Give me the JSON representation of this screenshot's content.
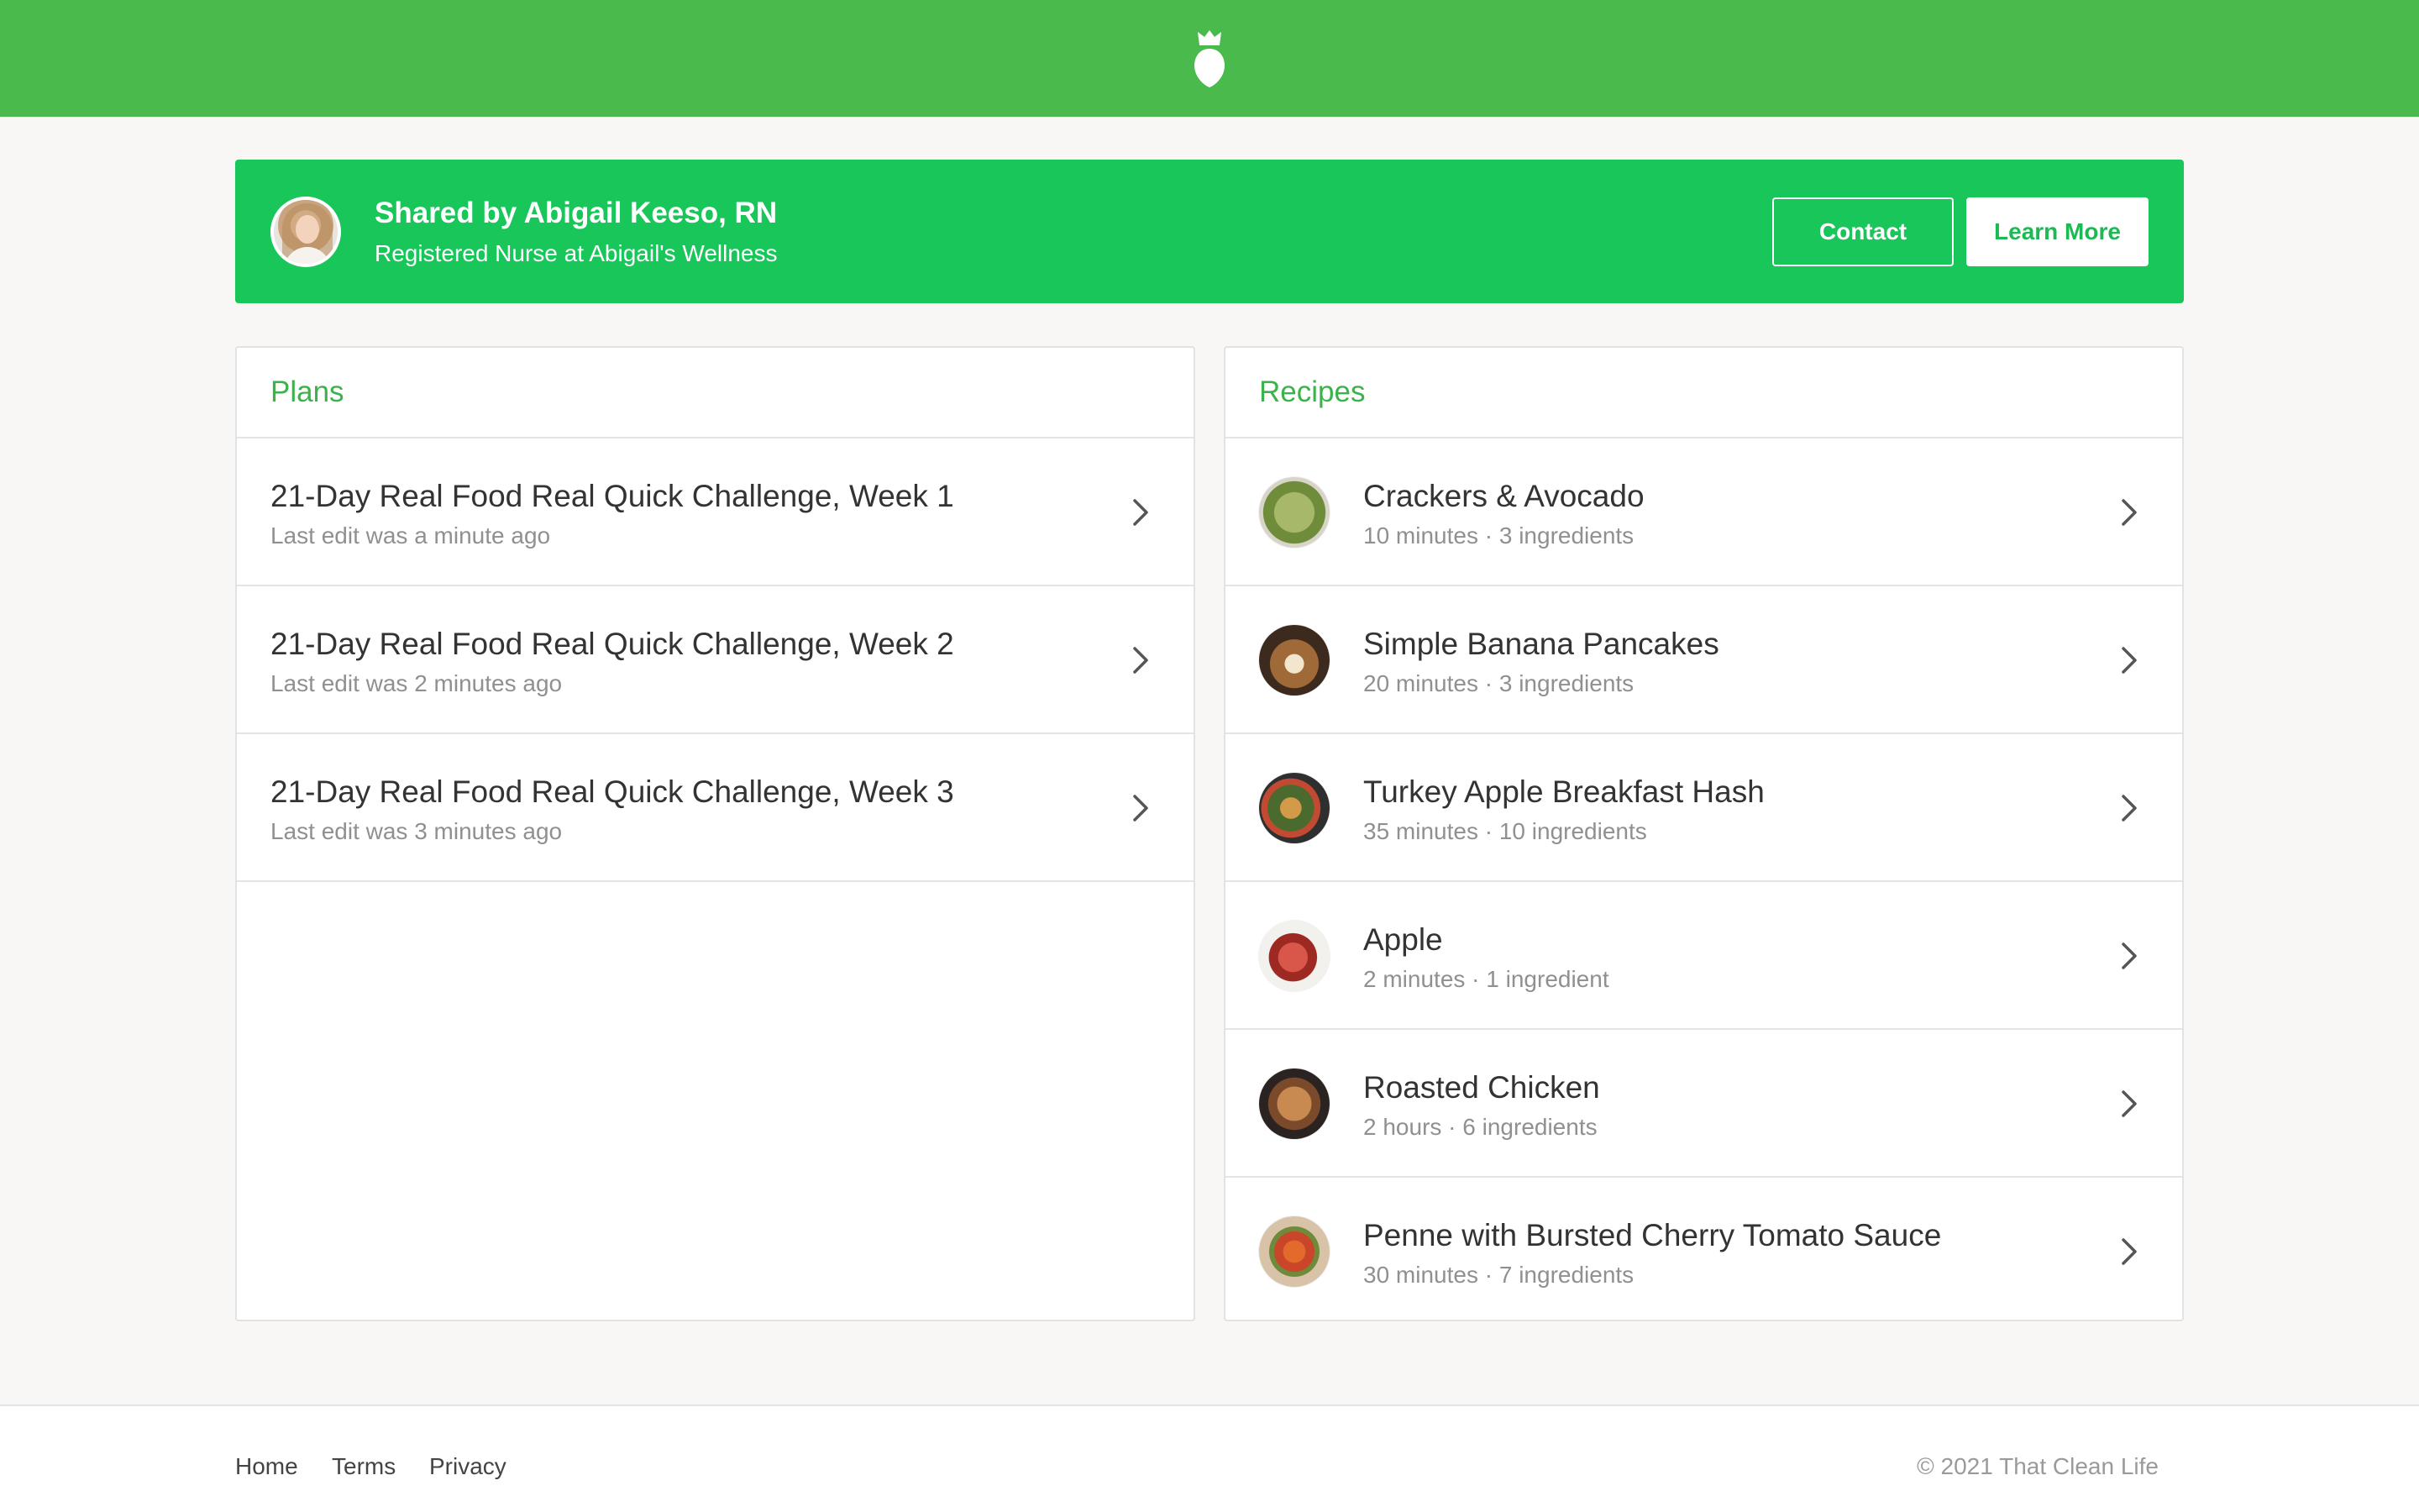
{
  "colors": {
    "brand_green": "#4aba4d",
    "banner_green": "#18c65a",
    "accent_green": "#3bb34a"
  },
  "header": {
    "logo_icon": "sprout-logo-icon"
  },
  "share": {
    "title": "Shared by Abigail Keeso, RN",
    "subtitle": "Registered Nurse at Abigail's Wellness",
    "contact_label": "Contact",
    "learn_more_label": "Learn More"
  },
  "plans": {
    "title": "Plans",
    "items": [
      {
        "title": "21-Day Real Food Real Quick Challenge, Week 1",
        "meta": "Last edit was a minute ago"
      },
      {
        "title": "21-Day Real Food Real Quick Challenge, Week 2",
        "meta": "Last edit was 2 minutes ago"
      },
      {
        "title": "21-Day Real Food Real Quick Challenge, Week 3",
        "meta": "Last edit was 3 minutes ago"
      }
    ]
  },
  "recipes": {
    "title": "Recipes",
    "items": [
      {
        "title": "Crackers & Avocado",
        "meta": "10 minutes · 3 ingredients"
      },
      {
        "title": "Simple Banana Pancakes",
        "meta": "20 minutes · 3 ingredients"
      },
      {
        "title": "Turkey Apple Breakfast Hash",
        "meta": "35 minutes · 10 ingredients"
      },
      {
        "title": "Apple",
        "meta": "2 minutes · 1 ingredient"
      },
      {
        "title": "Roasted Chicken",
        "meta": "2 hours · 6 ingredients"
      },
      {
        "title": "Penne with Bursted Cherry Tomato Sauce",
        "meta": "30 minutes · 7 ingredients"
      }
    ]
  },
  "footer": {
    "home": "Home",
    "terms": "Terms",
    "privacy": "Privacy",
    "copyright": "© 2021 That Clean Life"
  }
}
